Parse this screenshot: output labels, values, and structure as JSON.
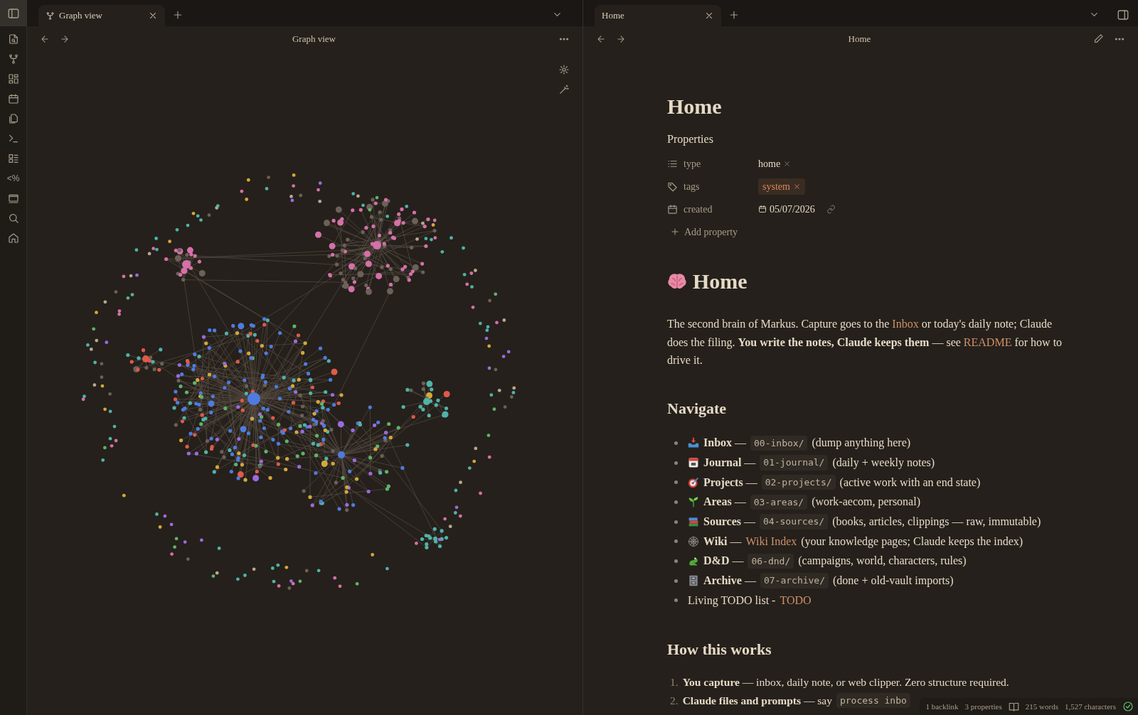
{
  "ribbon": {
    "templater_label": "<%"
  },
  "left_pane": {
    "tabs": [
      {
        "label": "Graph view",
        "selected": true
      }
    ],
    "header_title": "Graph view"
  },
  "right_pane": {
    "tabs": [
      {
        "label": "Home",
        "selected": true
      }
    ],
    "header_title": "Home"
  },
  "note": {
    "title": "Home",
    "properties_heading": "Properties",
    "properties": [
      {
        "kind": "list",
        "name": "type",
        "value": "home"
      },
      {
        "kind": "tags",
        "name": "tags",
        "value": "system"
      },
      {
        "kind": "date",
        "name": "created",
        "value": "05/07/2026"
      }
    ],
    "add_property": "Add property",
    "heading": "Home",
    "intro": [
      {
        "text": "The second brain of Markus. Capture goes to the "
      },
      {
        "link": "Inbox"
      },
      {
        "text": " or today's daily note; Claude does the filing. **You write the notes, Claude keeps them** — see "
      },
      {
        "link": "README"
      },
      {
        "text": " for how to drive it."
      }
    ],
    "navigate_heading": "Navigate",
    "navigate": [
      {
        "kind": "folder",
        "label": "**Inbox** —",
        "folder": "00-inbox/",
        "note": "(dump anything here)"
      },
      {
        "kind": "folder",
        "label": "**Journal** —",
        "folder": "01-journal/",
        "note": "(daily + weekly notes)"
      },
      {
        "kind": "folder",
        "label": "**Projects** —",
        "folder": "02-projects/",
        "note": "(active work with an end state)"
      },
      {
        "kind": "folder",
        "label": "**Areas** —",
        "folder": "03-areas/",
        "note": "(work-aecom, personal)"
      },
      {
        "kind": "folder",
        "label": "**Sources** —",
        "folder": "04-sources/",
        "note": "(books, articles, clippings — raw, immutable)"
      },
      {
        "kind": "link",
        "label": "**Wiki** —",
        "link": "Wiki Index",
        "note": "(your knowledge pages; Claude keeps the index)"
      },
      {
        "kind": "folder",
        "label": "**D&D** —",
        "folder": "06-dnd/",
        "note": "(campaigns, world, characters, rules)"
      },
      {
        "kind": "folder",
        "label": "**Archive** —",
        "folder": "07-archive/",
        "note": "(done + old-vault imports)"
      },
      {
        "kind": "plain",
        "label": "Living TODO list -",
        "link": "TODO"
      }
    ],
    "how_heading": "How this works",
    "steps": [
      {
        "number": "1.",
        "text": "**You capture** — inbox, daily note, or web clipper. Zero structure required."
      },
      {
        "number": "2.",
        "text": "**Claude files and prompts** — say",
        "code": "process inbo"
      }
    ]
  },
  "status_bar": {
    "backlinks": "1 backlink",
    "properties": "3 properties",
    "words": "215 words",
    "characters": "1,527 characters"
  }
}
